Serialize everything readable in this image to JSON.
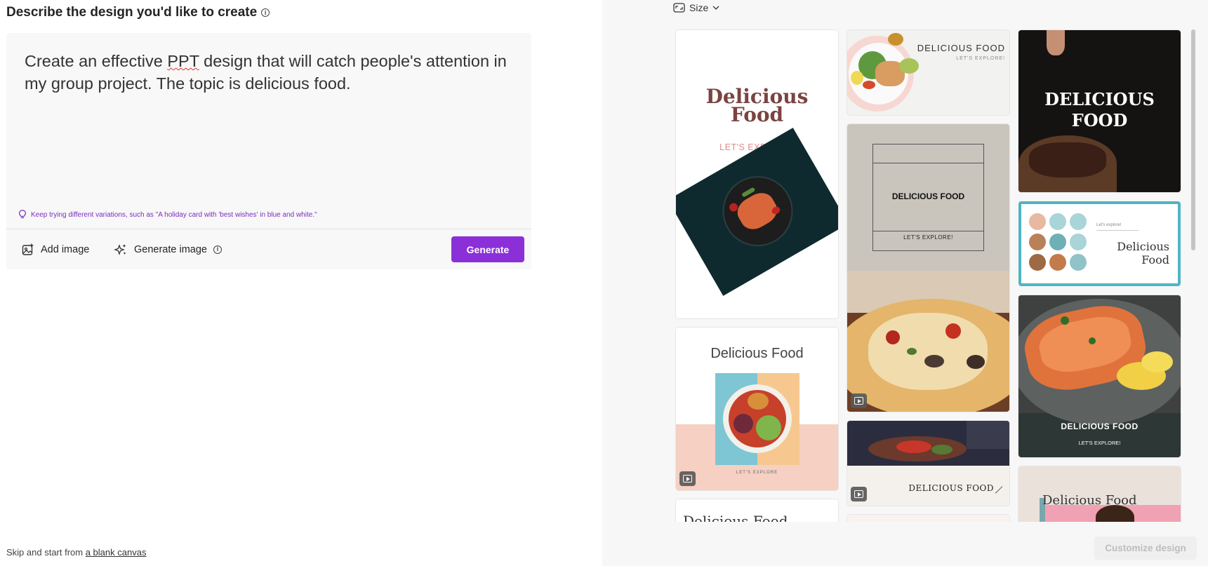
{
  "heading": "Describe the design you'd like to create",
  "prompt": {
    "before": "Create an effective ",
    "underlined": "PPT",
    "after": " design that will catch people's attention in my group project.  The topic is delicious food."
  },
  "tip": "Keep trying different variations, such as \"A holiday card with 'best wishes' in blue and white.\"",
  "actions": {
    "add_image": "Add image",
    "generate_image": "Generate image",
    "generate": "Generate"
  },
  "skip": {
    "prefix": "Skip and start from ",
    "link": "a blank canvas"
  },
  "size_label": "Size",
  "customize": "Customize design",
  "colors": {
    "accent": "#8b30d9",
    "tip": "#7a2bbf"
  },
  "designs": {
    "c1": {
      "title_l1": "Delicious",
      "title_l2": "Food",
      "sub": "LET'S EXPLORE!"
    },
    "c2": {
      "title": "Delicious Food",
      "sub": "LET'S EXPLORE"
    },
    "c3": {
      "title": "Delicious Food"
    },
    "c4": {
      "title": "DELICIOUS FOOD",
      "sub": "LET'S EXPLORE!"
    },
    "c5": {
      "title": "DELICIOUS FOOD",
      "sub": "LET'S EXPLORE!"
    },
    "c7": {
      "title": "DELICIOUS FOOD"
    },
    "c9": {
      "title_l1": "DELICIOUS",
      "title_l2": "FOOD"
    },
    "c10": {
      "small": "Let's explore!",
      "title_l1": "Delicious",
      "title_l2": "Food"
    },
    "c11": {
      "title": "DELICIOUS FOOD",
      "sub": "LET'S EXPLORE!"
    },
    "c12": {
      "title": "Delicious Food"
    }
  }
}
